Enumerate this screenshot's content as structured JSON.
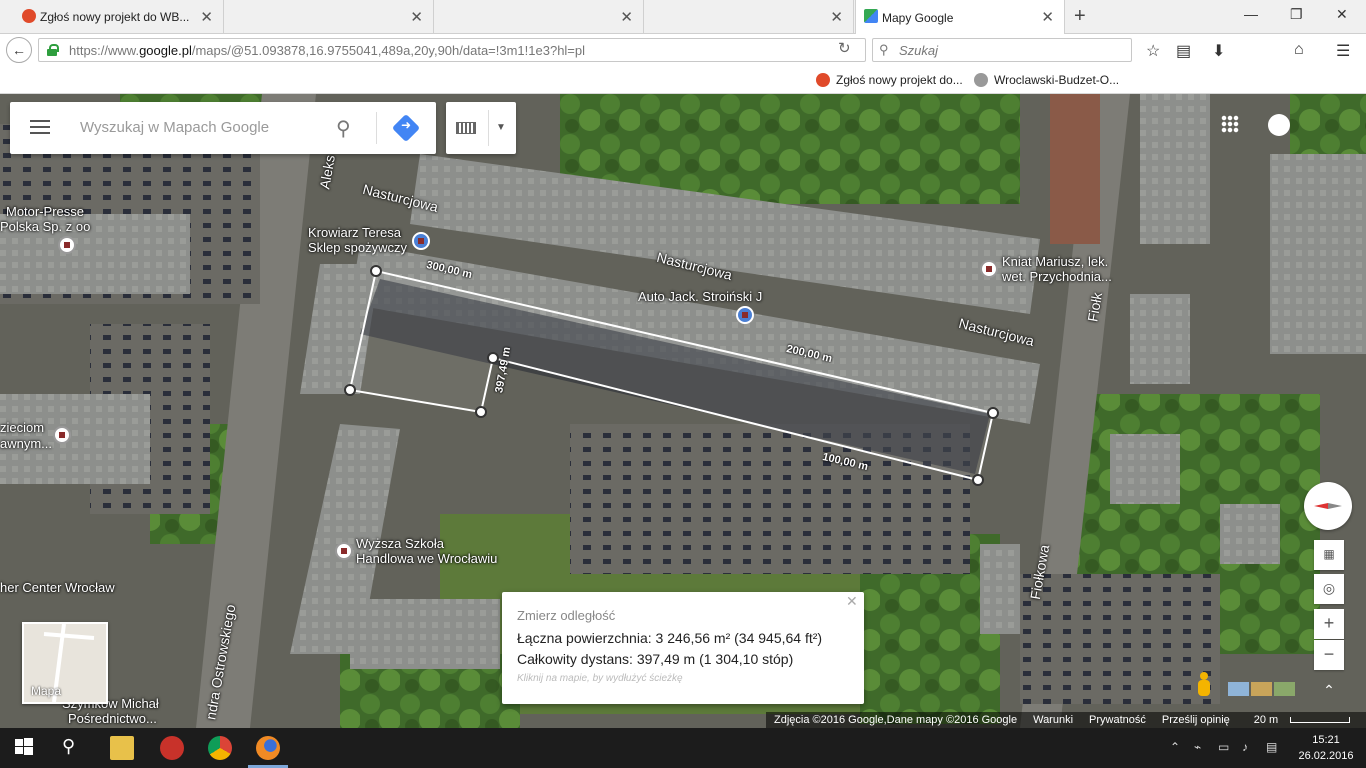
{
  "browser": {
    "tabs": [
      {
        "title": "Zgłoś nowy projekt do WB...",
        "active": false
      },
      {
        "title": "",
        "active": false
      },
      {
        "title": "",
        "active": false
      },
      {
        "title": "Mapy Google",
        "active": true
      }
    ],
    "url_prefix": "https://www.",
    "url_domain": "google.pl",
    "url_rest": "/maps/@51.093878,16.9755041,489a,20y,90h/data=!3m1!1e3?hl=pl",
    "search_placeholder": "Szukaj",
    "bookmarks": [
      "Zgłoś nowy projekt do...",
      "Wroclawski-Budzet-O..."
    ]
  },
  "maps": {
    "search_placeholder": "Wyszukaj w Mapach Google",
    "minimap_label": "Mapa",
    "labels": {
      "motor_presse": "Motor-Presse",
      "motor_presse2": "Polska Sp. z oo",
      "krowiarz": "Krowiarz Teresa",
      "krowiarz2": "Sklep spożywczy",
      "auto_jack": "Auto Jack. Stroiński J",
      "kniat": "Kniat Mariusz, lek.",
      "kniat2": "wet. Przychodnia...",
      "wyzsza": "Wyższa Szkoła",
      "wyzsza2": "Handlowa we Wrocławiu",
      "center": "her Center Wrocław",
      "dzieciom": "zieciom",
      "dzieciom2": "awnym...",
      "szyn": "Szymkow Michał",
      "szyn2": "Pośrednictwo...",
      "street_nast1": "Nasturcjowa",
      "street_nast2": "Nasturcjowa",
      "street_nast3": "Nasturcjowa",
      "street_alek": "Aleks",
      "street_fiolk1": "Fiołk",
      "street_fiolk2": "Fiołkowa",
      "street_ostr": "ndra Ostrowskiego"
    },
    "measure_labels": [
      "300,00 m",
      "200,00 m",
      "100,00 m",
      "397,49 m"
    ],
    "info": {
      "title": "Zmierz odległość",
      "area": "Łączna powierzchnia: 3 246,56 m² (34 945,64 ft²)",
      "distance": "Całkowity dystans: 397,49 m (1 304,10 stóp)",
      "hint": "Kliknij na mapie, by wydłużyć ścieżkę"
    },
    "footer": {
      "credits": "Zdjęcia ©2016 Google,Dane mapy ©2016 Google",
      "terms": "Warunki",
      "privacy": "Prywatność",
      "feedback": "Prześlij opinię",
      "scale": "20 m"
    }
  },
  "taskbar": {
    "time": "15:21",
    "date": "26.02.2016"
  }
}
